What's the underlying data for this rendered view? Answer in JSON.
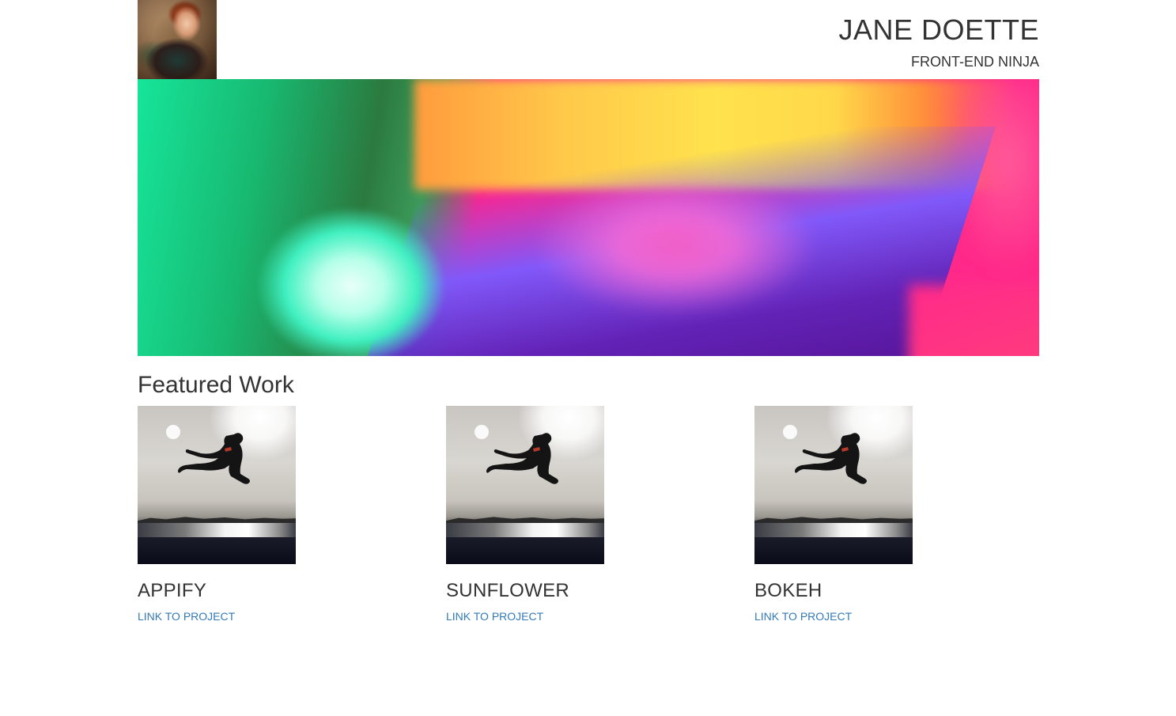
{
  "header": {
    "avatar_alt": "Jane Doette portrait",
    "name": "JANE DOETTE",
    "tagline": "FRONT-END NINJA"
  },
  "hero": {
    "alt": "colorful bokeh light banner"
  },
  "featured": {
    "title": "Featured Work",
    "projects": [
      {
        "title": "APPIFY",
        "link_label": "LINK TO PROJECT",
        "image_alt": "ninja jump kick silhouette"
      },
      {
        "title": "SUNFLOWER",
        "link_label": "LINK TO PROJECT",
        "image_alt": "ninja jump kick silhouette"
      },
      {
        "title": "BOKEH",
        "link_label": "LINK TO PROJECT",
        "image_alt": "ninja jump kick silhouette"
      }
    ]
  },
  "colors": {
    "text": "#333333",
    "link": "#337ab7",
    "background": "#ffffff"
  }
}
